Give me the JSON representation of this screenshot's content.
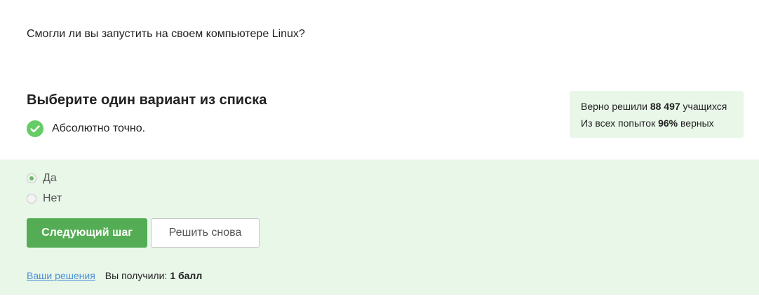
{
  "question": {
    "text": "Смогли ли вы запустить на своем компьютере Linux?"
  },
  "task": {
    "heading": "Выберите один вариант из списка",
    "feedback": "Абсолютно точно."
  },
  "stats": {
    "solved_prefix": "Верно решили",
    "solved_count": "88 497",
    "solved_suffix": "учащихся",
    "attempts_prefix": "Из всех попыток",
    "attempts_percent": "96%",
    "attempts_suffix": "верных"
  },
  "options": [
    {
      "label": "Да",
      "selected": true
    },
    {
      "label": "Нет",
      "selected": false
    }
  ],
  "buttons": {
    "next_label": "Следующий шаг",
    "retry_label": "Решить снова"
  },
  "footer": {
    "solutions_link": "Ваши решения",
    "score_label": "Вы получили:",
    "score_value": "1 балл"
  },
  "colors": {
    "accent_green": "#54ad54",
    "success_icon": "#66cc66",
    "answer_bg": "#e9f7e9",
    "link": "#4a8fd6"
  }
}
